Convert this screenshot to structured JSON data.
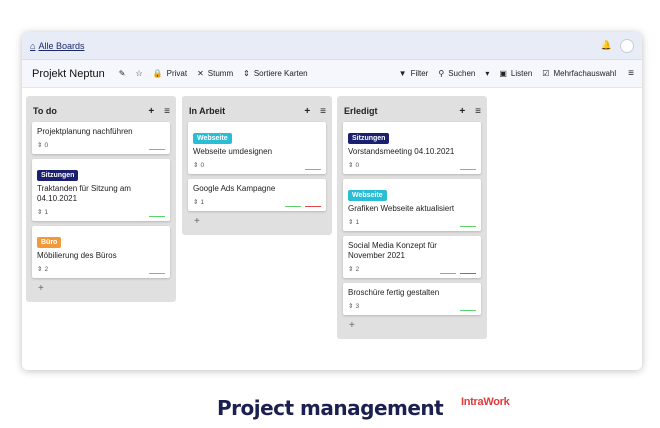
{
  "topbar": {
    "breadcrumb": "Alle Boards"
  },
  "board": {
    "title": "Projekt Neptun",
    "visibility": "Privat",
    "mute": "Stumm",
    "sort": "Sortiere Karten",
    "filter": "Filter",
    "search": "Suchen",
    "lists": "Listen",
    "multiselect": "Mehrfachauswahl"
  },
  "columns": [
    {
      "title": "To do",
      "cards": [
        {
          "label": "",
          "title": "Projektplanung nachführen",
          "count": "0",
          "bars": [
            "#5bd16a"
          ]
        },
        {
          "label": "Sitzungen",
          "label_color": "#1a1f6e",
          "title": "Traktanden für Sitzung am 04.10.2021",
          "count": "1",
          "bars": [
            "#5bd16a"
          ]
        },
        {
          "label": "Büro",
          "label_color": "#f29a3a",
          "title": "Möbilierung des Büros",
          "count": "2",
          "bars": [
            "#5bd16a"
          ]
        }
      ]
    },
    {
      "title": "In Arbeit",
      "cards": [
        {
          "label": "Webseite",
          "label_color": "#29bdd6",
          "title": "Webseite umdesignen",
          "count": "0",
          "bars": [
            "#5bd16a"
          ]
        },
        {
          "label": "",
          "title": "Google Ads Kampagne",
          "count": "1",
          "bars": [
            "#5bd16a",
            "#e44a4a"
          ]
        }
      ]
    },
    {
      "title": "Erledigt",
      "cards": [
        {
          "label": "Sitzungen",
          "label_color": "#1a1f6e",
          "title": "Vorstandsmeeting 04.10.2021",
          "count": "0",
          "bars": [
            "#5bd16a"
          ]
        },
        {
          "label": "Webseite",
          "label_color": "#29bdd6",
          "title": "Grafiken Webseite aktualisiert",
          "count": "1",
          "bars": [
            "#5bd16a"
          ]
        },
        {
          "label": "",
          "title": "Social Media Konzept für November 2021",
          "count": "2",
          "bars": [
            "#5bd16a",
            "#e44a4a"
          ]
        },
        {
          "label": "",
          "title": "Broschüre fertig gestalten",
          "count": "3",
          "bars": [
            "#5bd16a"
          ]
        }
      ]
    }
  ],
  "footer": {
    "title": "Project management",
    "brand": "IntraWork"
  }
}
